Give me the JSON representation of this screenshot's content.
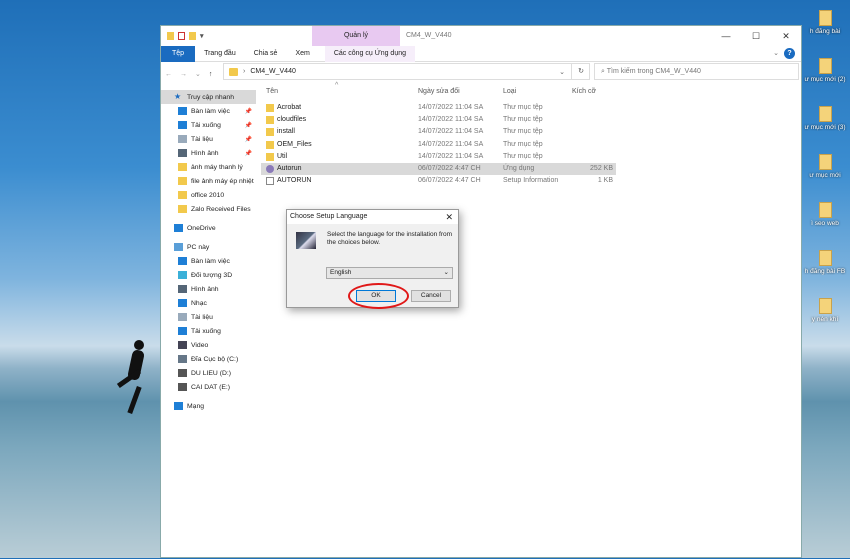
{
  "window": {
    "title": "CM4_W_V440",
    "context_group": "Quản lý"
  },
  "ribbon": {
    "tabs": [
      "Tệp",
      "Trang đầu",
      "Chia sẻ",
      "Xem"
    ],
    "context_tab": "Các công cụ Ứng dụng",
    "help": "?"
  },
  "address": {
    "path": "CM4_W_V440",
    "search_placeholder": "Tìm kiếm trong CM4_W_V440"
  },
  "window_controls": {
    "minimize": "—",
    "maximize": "☐",
    "close": "✕"
  },
  "sidebar": {
    "items": [
      {
        "label": "Truy cập nhanh",
        "icon": "star-icon",
        "color": "#1a6bc0",
        "selected": true,
        "level": 0
      },
      {
        "label": "Bàn làm việc",
        "icon": "desktop-icon",
        "color": "#1e7fd6",
        "pinned": true,
        "level": 1
      },
      {
        "label": "Tải xuống",
        "icon": "download-icon",
        "color": "#1e7fd6",
        "pinned": true,
        "level": 1
      },
      {
        "label": "Tài liệu",
        "icon": "document-icon",
        "color": "#9ab",
        "pinned": true,
        "level": 1
      },
      {
        "label": "Hình ảnh",
        "icon": "pictures-icon",
        "color": "#567",
        "pinned": true,
        "level": 1
      },
      {
        "label": "ảnh máy thanh lý",
        "icon": "folder-icon",
        "color": "#f2c94c",
        "level": 1
      },
      {
        "label": "file ảnh máy ép nhiệt",
        "icon": "folder-icon",
        "color": "#f2c94c",
        "level": 1
      },
      {
        "label": "office 2010",
        "icon": "folder-icon",
        "color": "#f2c94c",
        "level": 1
      },
      {
        "label": "Zalo Received Files",
        "icon": "folder-icon",
        "color": "#f2c94c",
        "level": 1
      },
      {
        "label": "OneDrive",
        "icon": "cloud-icon",
        "color": "#1e7fd6",
        "level": 0,
        "gap": true
      },
      {
        "label": "PC này",
        "icon": "computer-icon",
        "color": "#5a9fd8",
        "level": 0,
        "gap": true
      },
      {
        "label": "Bàn làm việc",
        "icon": "desktop-icon",
        "color": "#1e7fd6",
        "level": 1
      },
      {
        "label": "Đối tượng 3D",
        "icon": "cube-icon",
        "color": "#3bb0d8",
        "level": 1
      },
      {
        "label": "Hình ảnh",
        "icon": "pictures-icon",
        "color": "#567",
        "level": 1
      },
      {
        "label": "Nhạc",
        "icon": "music-icon",
        "color": "#1e7fd6",
        "level": 1
      },
      {
        "label": "Tài liệu",
        "icon": "document-icon",
        "color": "#9ab",
        "level": 1
      },
      {
        "label": "Tải xuống",
        "icon": "download-icon",
        "color": "#1e7fd6",
        "level": 1
      },
      {
        "label": "Video",
        "icon": "video-icon",
        "color": "#445",
        "level": 1
      },
      {
        "label": "Đĩa Cục bộ (C:)",
        "icon": "drive-icon",
        "color": "#678",
        "level": 1
      },
      {
        "label": "DU LIEU (D:)",
        "icon": "drive-icon",
        "color": "#555",
        "level": 1
      },
      {
        "label": "CAI DAT (E:)",
        "icon": "drive-icon",
        "color": "#555",
        "level": 1
      },
      {
        "label": "Mạng",
        "icon": "network-icon",
        "color": "#1e7fd6",
        "level": 0,
        "gap": true
      }
    ]
  },
  "columns": {
    "name": "Tên",
    "date": "Ngày sửa đổi",
    "type": "Loại",
    "size": "Kích cỡ"
  },
  "files": [
    {
      "name": "Acrobat",
      "date": "14/07/2022 11:04 SA",
      "type": "Thư mục tệp",
      "size": "",
      "icon": "folder-icon"
    },
    {
      "name": "cloudfiles",
      "date": "14/07/2022 11:04 SA",
      "type": "Thư mục tệp",
      "size": "",
      "icon": "folder-icon"
    },
    {
      "name": "install",
      "date": "14/07/2022 11:04 SA",
      "type": "Thư mục tệp",
      "size": "",
      "icon": "folder-icon"
    },
    {
      "name": "OEM_Files",
      "date": "14/07/2022 11:04 SA",
      "type": "Thư mục tệp",
      "size": "",
      "icon": "folder-icon"
    },
    {
      "name": "Util",
      "date": "14/07/2022 11:04 SA",
      "type": "Thư mục tệp",
      "size": "",
      "icon": "folder-icon"
    },
    {
      "name": "Autorun",
      "date": "06/07/2022 4:47 CH",
      "type": "Ứng dụng",
      "size": "252 KB",
      "icon": "app-icon",
      "selected": true
    },
    {
      "name": "AUTORUN",
      "date": "06/07/2022 4:47 CH",
      "type": "Setup Information",
      "size": "1 KB",
      "icon": "inf-file-icon"
    }
  ],
  "dialog": {
    "title": "Choose Setup Language",
    "message": "Select the language for the installation from the choices below.",
    "language": "English",
    "ok": "OK",
    "cancel": "Cancel"
  },
  "desktop_icons": [
    "h đăng bài",
    "ư mục mới (2)",
    "ư mục mới (3)",
    "ư mục mới",
    "ì seo web",
    "h đăng bài FB",
    "y nén khí"
  ],
  "colors": {
    "accent": "#1a6bc0",
    "context_tab": "#e8c9f1",
    "highlight_ring": "#e01818"
  }
}
